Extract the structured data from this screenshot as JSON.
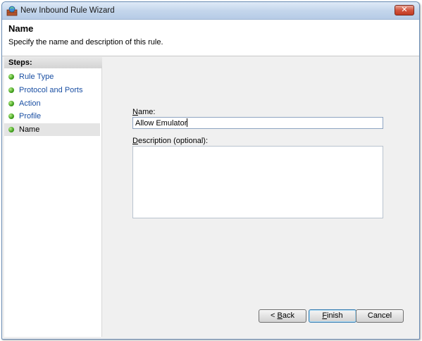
{
  "window": {
    "title": "New Inbound Rule Wizard",
    "close_glyph": "✕"
  },
  "header": {
    "title": "Name",
    "description": "Specify the name and description of this rule."
  },
  "steps": {
    "heading": "Steps:",
    "items": [
      {
        "label": "Rule Type"
      },
      {
        "label": "Protocol and Ports"
      },
      {
        "label": "Action"
      },
      {
        "label": "Profile"
      },
      {
        "label": "Name",
        "current": true
      }
    ]
  },
  "form": {
    "name_label_accel": "N",
    "name_label_rest": "ame:",
    "name_value": "Allow Emulator",
    "description_label_accel": "D",
    "description_label_rest": "escription (optional):",
    "description_value": ""
  },
  "buttons": {
    "back_symbol": "< ",
    "back_accel": "B",
    "back_rest": "ack",
    "finish_accel": "F",
    "finish_rest": "inish",
    "cancel": "Cancel"
  },
  "colors": {
    "step_link": "#1a4fa3",
    "step_dot": "#3f9e1c",
    "close_button": "#c13a22"
  },
  "icons": [
    "firewall-wizard-icon",
    "close-icon",
    "step-complete-dot-icon"
  ]
}
